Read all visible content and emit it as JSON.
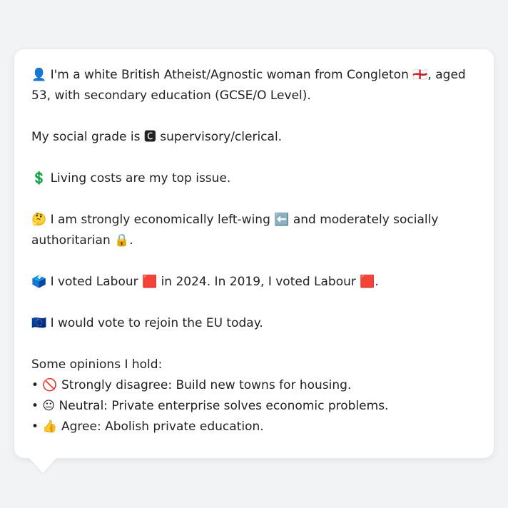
{
  "profile": {
    "intro": "👤 I'm a white British Atheist/Agnostic woman from Congleton 🏴󠁧󠁢󠁥󠁮󠁧󠁿, aged 53, with secondary education (GCSE/O Level).",
    "social_grade": "My social grade is 🅲 supervisory/clerical.",
    "top_issue": "💲 Living costs are my top issue.",
    "ideology": "🤔 I am strongly economically left-wing ⬅️ and moderately socially authoritarian 🔒.",
    "votes": "🗳️ I voted Labour 🟥 in 2024. In 2019, I voted Labour 🟥.",
    "eu": "🇪🇺 I would vote to rejoin the EU today.",
    "opinions_heading": "Some opinions I hold:",
    "opinions": [
      "• 🚫 Strongly disagree: Build new towns for housing.",
      "• 😐 Neutral: Private enterprise solves economic problems.",
      "• 👍 Agree: Abolish private education."
    ]
  }
}
